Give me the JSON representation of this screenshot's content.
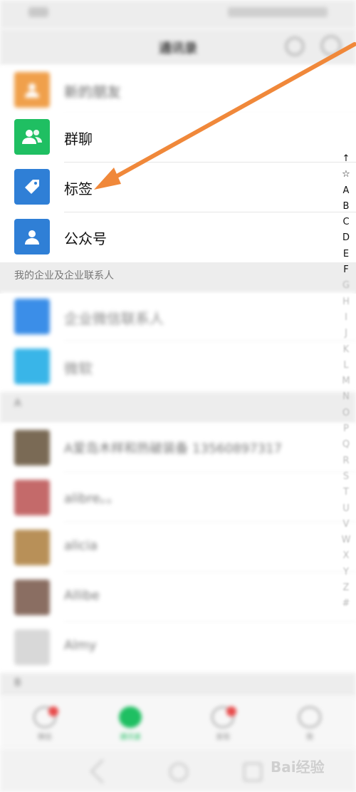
{
  "status_bar": {
    "left": "",
    "right": ""
  },
  "header": {
    "title": "通讯录"
  },
  "menu_items": [
    {
      "id": "new-friends",
      "label": "新的朋友",
      "color": "#f0a04b"
    },
    {
      "id": "group-chat",
      "label": "群聊",
      "color": "#1fbf62"
    },
    {
      "id": "tags",
      "label": "标签",
      "color": "#2f7fd6"
    },
    {
      "id": "official-accounts",
      "label": "公众号",
      "color": "#2f7fd6"
    }
  ],
  "enterprise_section": {
    "title": "我的企业及企业联系人",
    "items": [
      {
        "label": "企业微信联系人",
        "color": "#3b8ee8"
      },
      {
        "label": "微软",
        "color": "#39b5e8"
      }
    ]
  },
  "contacts_section": {
    "title": "A",
    "contacts": [
      {
        "name": "A爱岛木样和热破装备 13560897317"
      },
      {
        "name": "alibre。。"
      },
      {
        "name": "alicia"
      },
      {
        "name": "Allibe"
      },
      {
        "name": "Almy"
      }
    ],
    "next_section": "B"
  },
  "index_bar": [
    "↑",
    "☆",
    "A",
    "B",
    "C",
    "D",
    "E",
    "F",
    "G",
    "H",
    "I",
    "J",
    "K",
    "L",
    "M",
    "N",
    "O",
    "P",
    "Q",
    "R",
    "S",
    "T",
    "U",
    "V",
    "W",
    "X",
    "Y",
    "Z",
    "#"
  ],
  "tabs": [
    {
      "label": "微信",
      "badge": true
    },
    {
      "label": "通讯录",
      "badge": false
    },
    {
      "label": "发现",
      "badge": true
    },
    {
      "label": "我",
      "badge": false
    }
  ],
  "watermark": "Bai经验",
  "colors": {
    "arrow": "#f0883a",
    "active_tab": "#1fbf62"
  }
}
